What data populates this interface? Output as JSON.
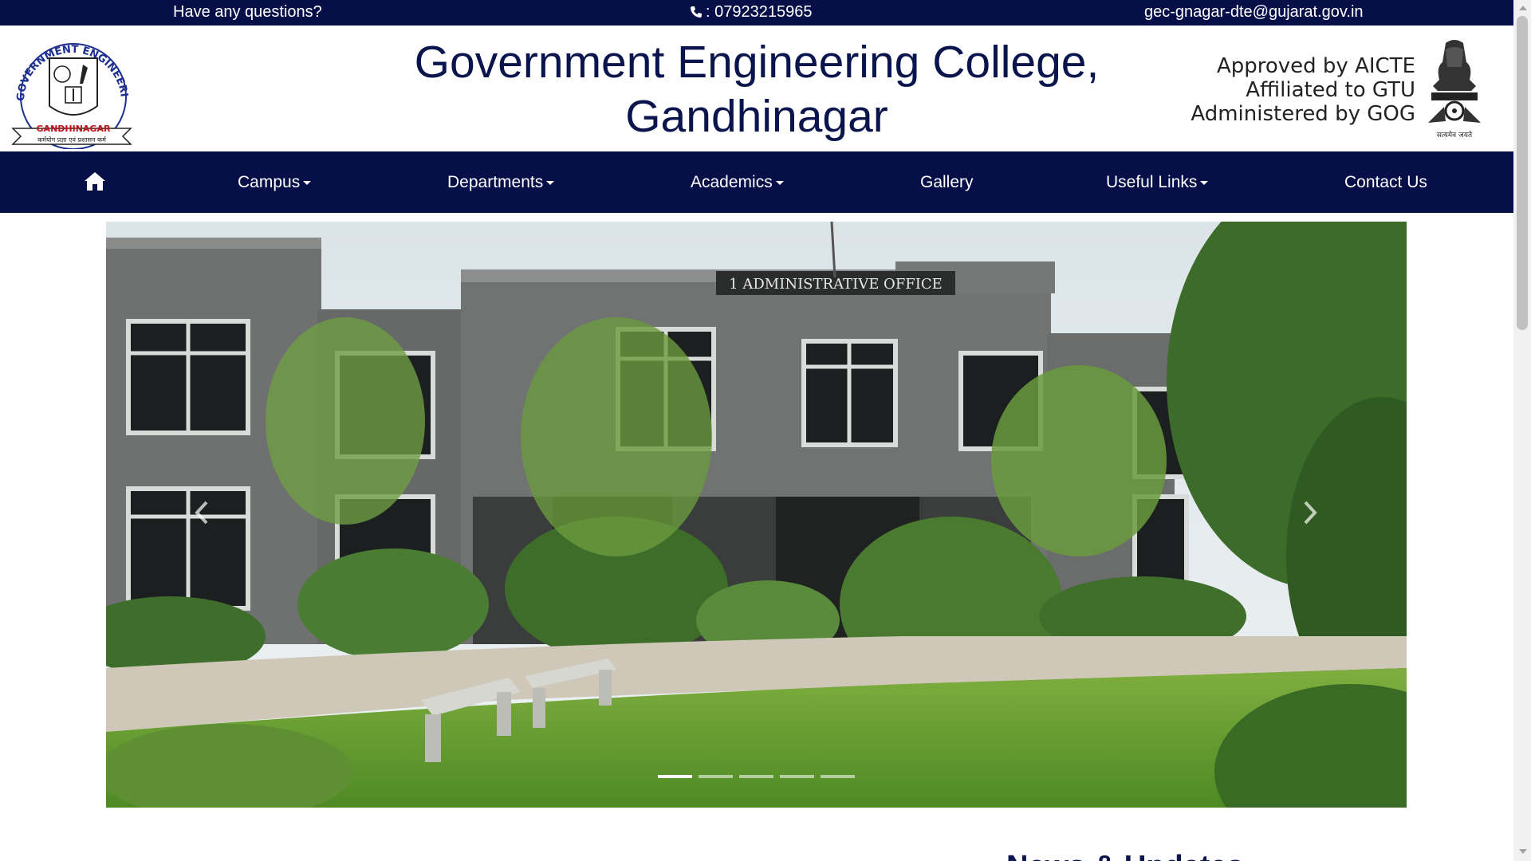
{
  "topbar": {
    "question": "Have any questions?",
    "phone": ": 07923215965",
    "email": "gec-gnagar-dte@gujarat.gov.in",
    "phone_icon": "phone-icon"
  },
  "header": {
    "title_line1": "Government Engineering College,",
    "title_line2": "Gandhinagar",
    "approval_1": "Approved by AICTE",
    "approval_2": "Affiliated to GTU",
    "approval_3": "Administered by GOG",
    "logo_ring_text": "GOVERNMENT ENGINEERING COLLEGE",
    "logo_banner": "GANDHINAGAR",
    "logo_motto": "कर्मयोग प्रज्ञा एवं प्रशासन कर्म",
    "emblem_motto": "सत्यमेव जयते"
  },
  "nav": {
    "home_icon": "home-icon",
    "items": [
      {
        "label": "Campus",
        "dropdown": true
      },
      {
        "label": "Departments",
        "dropdown": true
      },
      {
        "label": "Academics",
        "dropdown": true
      },
      {
        "label": "Gallery",
        "dropdown": false
      },
      {
        "label": "Useful Links",
        "dropdown": true
      },
      {
        "label": "Contact Us",
        "dropdown": false
      }
    ]
  },
  "carousel": {
    "slide_sign": "1 ADMINISTRATIVE OFFICE",
    "slide_count": 5,
    "active_slide": 1,
    "prev_icon": "chevron-left-icon",
    "next_icon": "chevron-right-icon"
  },
  "news": {
    "heading": "News & Updates"
  },
  "colors": {
    "brand_navy": "#060f47",
    "title_navy": "#0b154d",
    "white": "#ffffff"
  }
}
